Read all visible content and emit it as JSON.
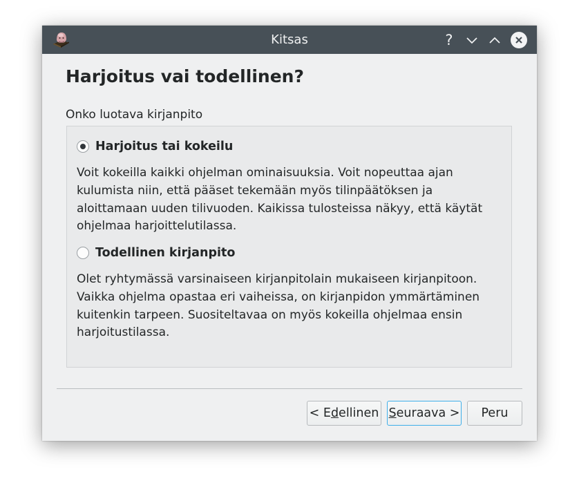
{
  "window": {
    "title": "Kitsas"
  },
  "titlebar": {
    "help_glyph": "?",
    "icons": [
      "kitsas-app-icon",
      "help-icon",
      "minimize-icon",
      "maximize-icon",
      "close-icon"
    ]
  },
  "page": {
    "heading": "Harjoitus vai todellinen?",
    "group_label": "Onko luotava kirjanpito"
  },
  "options": [
    {
      "label": "Harjoitus tai kokeilu",
      "selected": true,
      "description": "Voit kokeilla kaikki ohjelman ominaisuuksia. Voit nopeuttaa ajan kulumista niin, että pääset tekemään myös tilinpäätöksen ja aloittamaan uuden tilivuoden. Kaikissa tulosteissa näkyy, että käytät ohjelmaa harjoittelutilassa."
    },
    {
      "label": "Todellinen kirjanpito",
      "selected": false,
      "description": "Olet ryhtymässä varsinaiseen kirjanpitolain mukaiseen kirjanpitoon. Vaikka ohjelma opastaa eri vaiheissa, on kirjanpidon ymmärtäminen kuitenkin tarpeen. Suositeltavaa on myös kokeilla ohjelmaa ensin harjoitustilassa."
    }
  ],
  "buttons": {
    "back_prefix": "< E",
    "back_mnemonic": "d",
    "back_suffix": "ellinen",
    "next_mnemonic": "S",
    "next_suffix": "euraava >",
    "cancel": "Peru"
  },
  "colors": {
    "titlebar": "#475057",
    "window_bg": "#eff0f1",
    "focus_accent": "#3daee9",
    "text": "#232627"
  }
}
